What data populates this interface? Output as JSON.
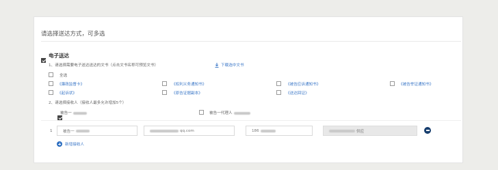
{
  "title": "请选择送达方式，可多选",
  "electronic": {
    "label": "电子送达",
    "step1": "1、请选择需要电子送达送达的文书（点击文书名称可预览文书）",
    "download": "下载选中文书",
    "select_all": "全选",
    "docs": [
      "《廉政监督卡》",
      "《权利义务通知书》",
      "《被告应诉通知书》",
      "《被告举证通知书》",
      "《起诉状》",
      "《原告证据副本》",
      "《送达回证》"
    ],
    "step2": "2、请选择接收人（接收人最多允许增加5个）",
    "recipients": [
      "被告一",
      "被告一代理人"
    ],
    "row_index": "1",
    "row_name": "被告一",
    "row_email_suffix": "qq.com",
    "row_phone_prefix": "186",
    "row_address_suffix": "供应",
    "add_label": "新增接收人"
  }
}
